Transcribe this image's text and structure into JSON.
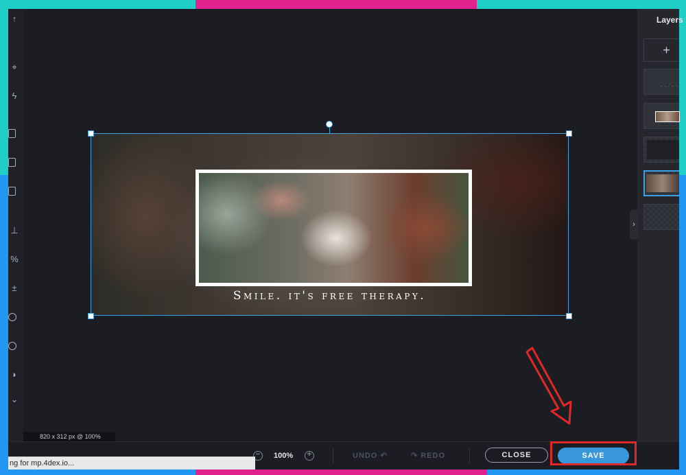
{
  "colors": {
    "accent": "#3896db",
    "selection": "#3da3e8",
    "highlight": "#e0282a",
    "frame_teal": "#1fcfc7",
    "frame_pink": "#e0228e",
    "frame_blue": "#2196f3"
  },
  "left_toolbar": {
    "icons": [
      "arrow-up-icon",
      "pin-icon",
      "lightning-icon",
      "grid-icon",
      "crop-icon",
      "layout-icon",
      "shapes-icon",
      "scissors-icon",
      "adjust-icon",
      "circle-icon",
      "badge-icon",
      "drop-icon",
      "caret-icon"
    ]
  },
  "canvas": {
    "caption": "Smile. it's free therapy.",
    "size_label": "820 x 312 px @ 100%"
  },
  "layers": {
    "title": "Layers",
    "add_symbol": "+",
    "items": [
      "transparent-text-layer",
      "photo-layer",
      "dark-layer",
      "selected-image-layer",
      "transparent-layer"
    ]
  },
  "panel_toggle": "›",
  "bottom_bar": {
    "zoom_out": "−",
    "zoom_level": "100%",
    "zoom_in": "+",
    "undo": "UNDO ↶",
    "redo": "↷ REDO",
    "close": "CLOSE",
    "save": "SAVE"
  },
  "status_bar": {
    "text": "ng for mp.4dex.io..."
  }
}
